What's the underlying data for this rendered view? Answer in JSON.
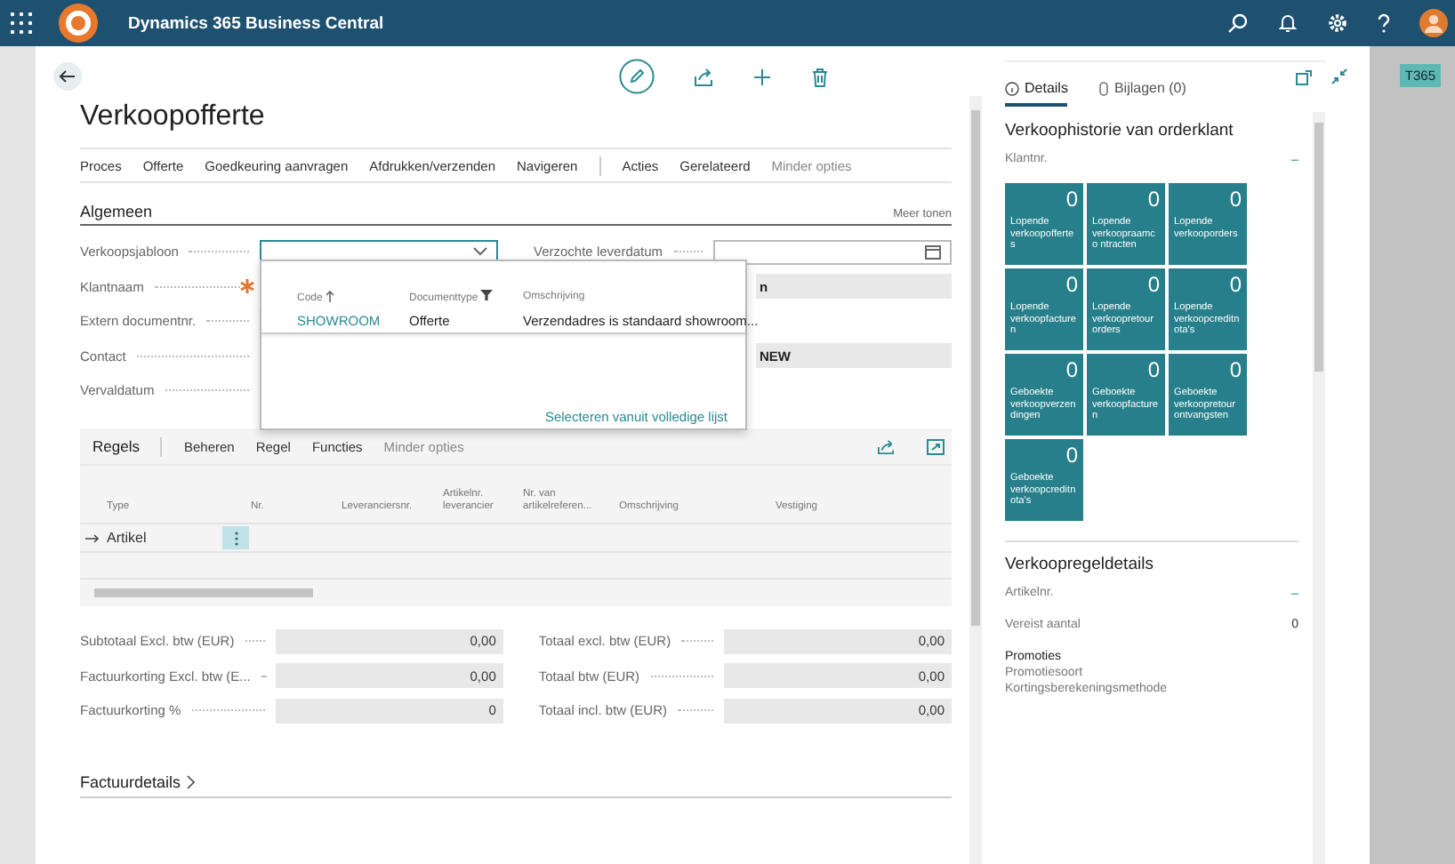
{
  "app": {
    "title": "Dynamics 365 Business Central",
    "env_badge": "T365"
  },
  "page": {
    "title": "Verkoopofferte"
  },
  "actions": [
    {
      "label": "Proces",
      "kind": "menu"
    },
    {
      "label": "Offerte",
      "kind": "menu"
    },
    {
      "label": "Goedkeuring aanvragen",
      "kind": "menu"
    },
    {
      "label": "Afdrukken/verzenden",
      "kind": "menu"
    },
    {
      "label": "Navigeren",
      "kind": "menu"
    },
    {
      "label": "Acties",
      "kind": "group_start"
    },
    {
      "label": "Gerelateerd",
      "kind": "menu"
    },
    {
      "label": "Minder opties",
      "kind": "toggle"
    }
  ],
  "general": {
    "title": "Algemeen",
    "more": "Meer tonen",
    "fields_left": [
      {
        "label": "Verkoopsjabloon",
        "kind": "dropdown",
        "required": false
      },
      {
        "label": "Klantnaam",
        "kind": "text",
        "required": true
      },
      {
        "label": "Extern documentnr.",
        "kind": "text",
        "required": false
      },
      {
        "label": "Contact",
        "kind": "text",
        "required": false
      },
      {
        "label": "Vervaldatum",
        "kind": "text",
        "required": false
      }
    ],
    "fields_right": [
      {
        "kind": "date",
        "label": "Verzochte leverdatum"
      },
      {
        "kind": "readonly",
        "value": "n"
      },
      {
        "kind": "blank"
      },
      {
        "kind": "readonly",
        "value": "NEW"
      }
    ],
    "lookup": {
      "columns": [
        {
          "label": "Code",
          "sorted": true,
          "filter": false
        },
        {
          "label": "Documenttype",
          "sorted": false,
          "filter": true
        },
        {
          "label": "Omschrijving",
          "sorted": false,
          "filter": false
        }
      ],
      "rows": [
        [
          "SHOWROOM",
          "Offerte",
          "Verzendadres is standaard showroom..."
        ]
      ],
      "footer_link": "Selecteren vanuit volledige lijst"
    }
  },
  "lines": {
    "title": "Regels",
    "actions": [
      {
        "label": "Beheren",
        "kind": "menu"
      },
      {
        "label": "Regel",
        "kind": "menu"
      },
      {
        "label": "Functies",
        "kind": "menu"
      },
      {
        "label": "Minder opties",
        "kind": "toggle"
      }
    ],
    "columns": [
      "Type",
      "Nr.",
      "Leveranciersnr.",
      "Artikelnr. leverancier",
      "Nr. van artikelreferen...",
      "Omschrijving",
      "Vestiging"
    ],
    "rows": [
      {
        "type": "Artikel",
        "current": true
      }
    ]
  },
  "totals_left": [
    {
      "label": "Subtotaal Excl. btw (EUR)",
      "value": "0,00"
    },
    {
      "label": "Factuurkorting Excl. btw (E...",
      "value": "0,00"
    },
    {
      "label": "Factuurkorting %",
      "value": "0"
    }
  ],
  "totals_right": [
    {
      "label": "Totaal excl. btw (EUR)",
      "value": "0,00"
    },
    {
      "label": "Totaal btw (EUR)",
      "value": "0,00"
    },
    {
      "label": "Totaal incl. btw (EUR)",
      "value": "0,00"
    }
  ],
  "sections": [
    {
      "title": "Factuurdetails",
      "expanded": false
    }
  ],
  "factbox": {
    "tabs": [
      {
        "label": "Details",
        "kind": "info",
        "selected": true
      },
      {
        "label": "Bijlagen (0)",
        "kind": "attach",
        "selected": false
      }
    ],
    "history_title": "Verkoophistorie van orderklant",
    "customer_label": "Klantnr.",
    "customer_value": "–",
    "tiles": [
      {
        "count": "0",
        "label": "Lopende verkoopofferte s"
      },
      {
        "count": "0",
        "label": "Lopende verkoopraamco ntracten"
      },
      {
        "count": "0",
        "label": "Lopende verkooporders"
      },
      {
        "count": "0",
        "label": "Lopende verkoopfacture n"
      },
      {
        "count": "0",
        "label": "Lopende verkoopretour orders"
      },
      {
        "count": "0",
        "label": "Lopende verkoopcreditn ota's"
      },
      {
        "count": "0",
        "label": "Geboekte verkoopverzen dingen"
      },
      {
        "count": "0",
        "label": "Geboekte verkoopfacture n"
      },
      {
        "count": "0",
        "label": "Geboekte verkoopretour ontvangsten"
      },
      {
        "count": "0",
        "label": "Geboekte verkoopcreditn ota's"
      }
    ],
    "line_title": "Verkoopregeldetails",
    "line_fields": [
      {
        "label": "Artikelnr.",
        "value": "–",
        "kind": "link"
      },
      {
        "label": "Vereist aantal",
        "value": "0",
        "kind": "plain"
      }
    ],
    "promo_title": "Promoties",
    "promo_fields": [
      "Promotiesoort",
      "Kortingsberekeningsmethode"
    ]
  }
}
